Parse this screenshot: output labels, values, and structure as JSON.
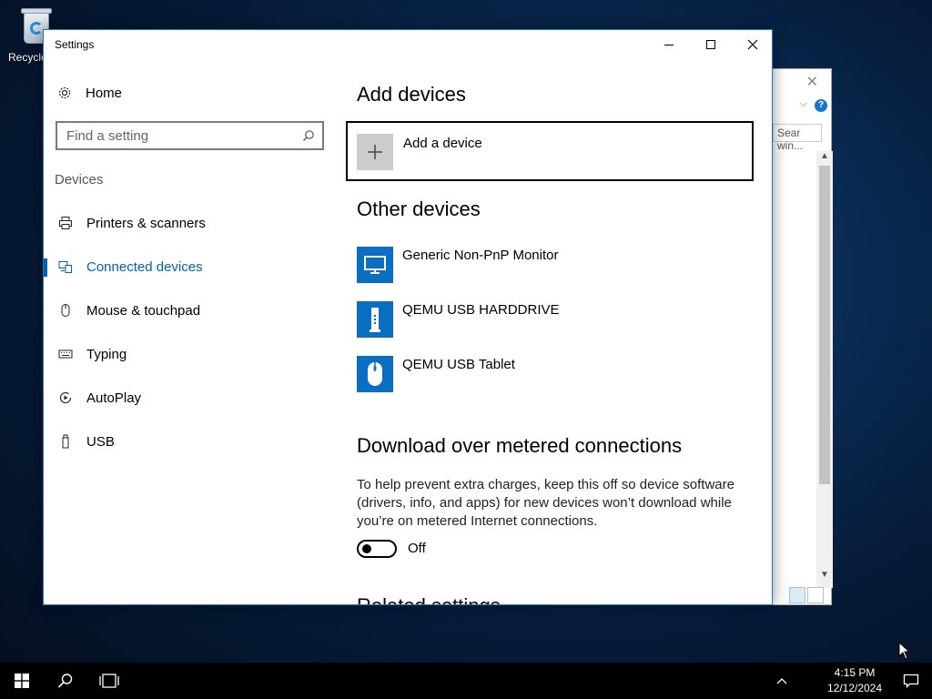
{
  "desktop": {
    "recycle_bin_label": "Recycle"
  },
  "background_window": {
    "close_glyph": "✕",
    "chevron_glyph": "⌵",
    "help_glyph": "?",
    "search_text": "Sear win..."
  },
  "window": {
    "title": "Settings",
    "controls": [
      "minimize",
      "maximize",
      "close"
    ]
  },
  "nav": {
    "home_label": "Home",
    "search_placeholder": "Find a setting",
    "section_label": "Devices",
    "items": [
      {
        "label": "Printers & scanners",
        "icon": "printer-icon",
        "active": false
      },
      {
        "label": "Connected devices",
        "icon": "connected-devices-icon",
        "active": true
      },
      {
        "label": "Mouse & touchpad",
        "icon": "mouse-icon",
        "active": false
      },
      {
        "label": "Typing",
        "icon": "keyboard-icon",
        "active": false
      },
      {
        "label": "AutoPlay",
        "icon": "autoplay-icon",
        "active": false
      },
      {
        "label": "USB",
        "icon": "usb-icon",
        "active": false
      }
    ]
  },
  "content": {
    "add_heading": "Add devices",
    "add_device_label": "Add a device",
    "other_heading": "Other devices",
    "devices": [
      {
        "name": "Generic Non-PnP Monitor",
        "icon": "monitor-icon"
      },
      {
        "name": "QEMU USB HARDDRIVE",
        "icon": "usb-drive-icon"
      },
      {
        "name": "QEMU USB Tablet",
        "icon": "mouse-device-icon"
      }
    ],
    "download_heading": "Download over metered connections",
    "download_desc": "To help prevent extra charges, keep this off so device software (drivers, info, and apps) for new devices won’t download while you’re on metered Internet connections.",
    "toggle_state": "Off",
    "related_heading": "Related settings"
  },
  "taskbar": {
    "time": "4:15 PM",
    "date": "12/12/2024"
  },
  "colors": {
    "accent": "#0063b1",
    "device_icon_bg": "#0a6fc2",
    "taskbar": "#000000"
  }
}
